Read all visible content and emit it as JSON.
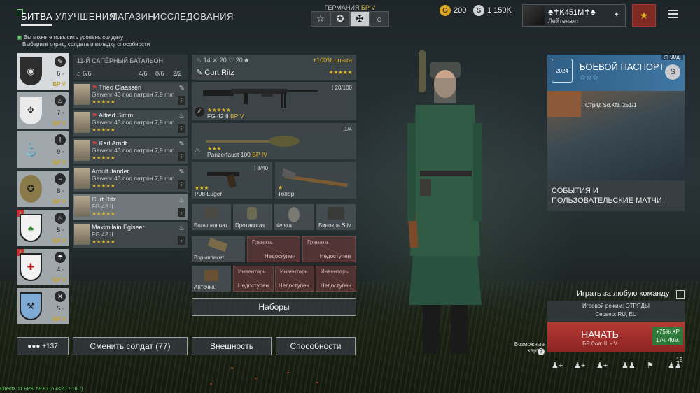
{
  "nav": {
    "tabs": [
      "БИТВА",
      "УЛУЧШЕНИЯ",
      "МАГАЗИН",
      "ИССЛЕДОВАНИЯ"
    ],
    "active_tab": "БИТВА"
  },
  "faction": {
    "name": "ГЕРМАНИЯ",
    "br": "БР V",
    "icons": [
      "star-outline-icon",
      "star-circle-icon",
      "iron-cross-icon",
      "circle-icon"
    ]
  },
  "currency": {
    "gold": "200",
    "silver": "1 150K"
  },
  "player": {
    "name": "♣✝K451M✝♣",
    "rank": "Лейтенант"
  },
  "hints": {
    "line1": "Вы можете повысить уровень солдату",
    "line2": "Выберите отряд, солдата и вкладку способности"
  },
  "squads": [
    {
      "count": "6",
      "br": "БР V",
      "class_icon": "wrench-icon"
    },
    {
      "count": "7",
      "br": "БР V",
      "class_icon": "flame-icon"
    },
    {
      "count": "9",
      "br": "БР V",
      "class_icon": "sniper-icon"
    },
    {
      "count": "8",
      "br": "БР V",
      "class_icon": "mg-icon"
    },
    {
      "count": "5",
      "br": "БР V",
      "class_icon": "flame-icon"
    },
    {
      "count": "4",
      "br": "БР V",
      "class_icon": "parachute-icon"
    },
    {
      "count": "5",
      "br": "БР V",
      "class_icon": "rifle-icon"
    }
  ],
  "battalion": {
    "title": "11-Й САПЁРНЫЙ БАТАЛЬОН",
    "slots1": "6/6",
    "slots2": "4/6",
    "slots3": "0/6",
    "slots4": "2/2"
  },
  "soldiers": [
    {
      "name": "Theo Claassen",
      "weapon": "Gewehr 43 под патрон 7,9 mm Kurz",
      "stars": "★★★★★"
    },
    {
      "name": "Alfred Simm",
      "weapon": "Gewehr 43 под патрон 7,9 mm Kurz",
      "stars": "★★★★★"
    },
    {
      "name": "Karl Arndt",
      "weapon": "Gewehr 43 под патрон 7,9 mm Kurz",
      "stars": "★★★★★"
    },
    {
      "name": "Arnulf Jander",
      "weapon": "Gewehr 43 под патрон 7,9 mm Kurz",
      "stars": "★★★★★"
    },
    {
      "name": "Curt Ritz",
      "weapon": "FG 42 II",
      "stars": "★★★★★"
    },
    {
      "name": "Maximilain Eglseer",
      "weapon": "FG 42 II",
      "stars": "★★★★★"
    }
  ],
  "character": {
    "stat1": "14",
    "stat2": "20",
    "stat3": "20",
    "exp_bonus": "+100% опыта",
    "name": "Curt Ritz",
    "stars": "★★★★★"
  },
  "equipment": {
    "primary": {
      "name": "FG 42 II",
      "br": "БР V",
      "ammo": "20/100",
      "stars": "★★★★★"
    },
    "secondary": {
      "name": "Panzerfaust 100",
      "br": "БР IV",
      "ammo": "1/4",
      "stars": "★★★"
    },
    "pistol": {
      "name": "P08 Luger",
      "ammo": "8/40",
      "stars": "★★★"
    },
    "melee": {
      "name": "Топор",
      "stars": "★"
    },
    "small": [
      "Большая пат",
      "Противогаз",
      "Фляга",
      "Бинокль Sliv"
    ],
    "grenade_slot": "Взрывпакет",
    "grenade_locked": [
      {
        "title": "Граната",
        "status": "Недоступен"
      },
      {
        "title": "Граната",
        "status": "Недоступен"
      }
    ],
    "medkit": "Аптечка",
    "inventory_locked": [
      {
        "title": "Инвентарь",
        "status": "Недоступен"
      },
      {
        "title": "Инвентарь",
        "status": "Недоступен"
      },
      {
        "title": "Инвентарь",
        "status": "Недоступен"
      }
    ]
  },
  "buttons": {
    "presets": "Наборы",
    "squad_size": "+137",
    "change_soldier": "Сменить солдат (77)",
    "appearance": "Внешность",
    "abilities": "Способности"
  },
  "battlepass": {
    "timer": "90д.",
    "title": "БОЕВОЙ ПАСПОРТ",
    "year": "2024",
    "stars": "☆☆☆",
    "reward": "Отряд Sd.Kfz. 251/1"
  },
  "events": {
    "label": "СОБЫТИЯ И ПОЛЬЗОВАТЕЛЬСКИЕ МАТЧИ"
  },
  "play_any_team": "Играть за любую команду",
  "game_mode": {
    "mode": "Игровой режим: ОТРЯДЫ",
    "server": "Сервер: RU, EU"
  },
  "start": {
    "label": "НАЧАТЬ",
    "br": "БР боя: III - V",
    "bonus_xp": "+75% XP",
    "bonus_time": "17ч. 40м."
  },
  "maps_label": "Возможные карты:",
  "social": {
    "notif_count": "12"
  },
  "debug": "DirectX 11 FPS: 59.8 (16.4<20.7 16.7)",
  "colors": {
    "accent_gold": "#e4b829",
    "start_red": "#b73a35",
    "bp_blue": "#3f76a2"
  }
}
